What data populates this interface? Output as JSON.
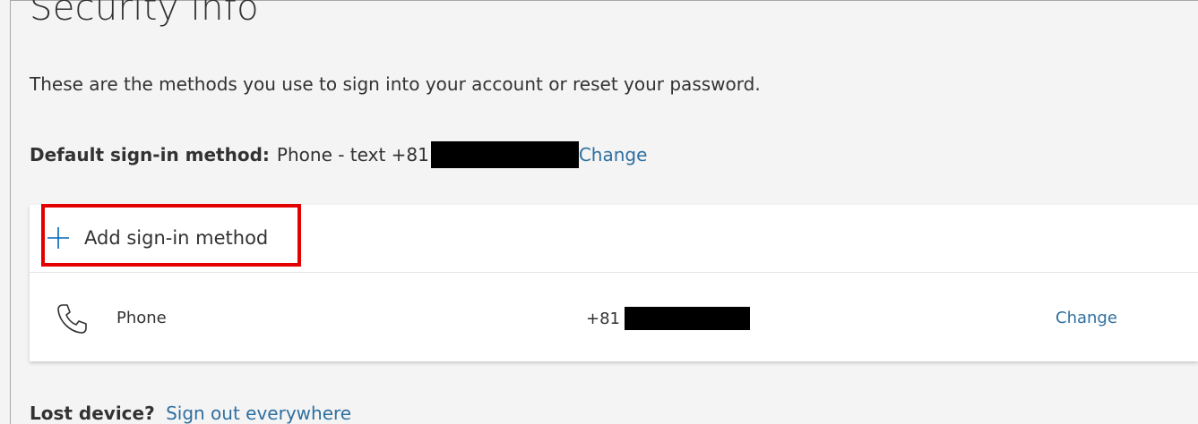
{
  "page": {
    "title": "Security info",
    "description": "These are the methods you use to sign into your account or reset your password."
  },
  "default_method": {
    "label": "Default sign-in method:",
    "value": "Phone - text +81",
    "change_link": "Change"
  },
  "add_method": {
    "label": "Add sign-in method",
    "icon": "plus-icon"
  },
  "methods": [
    {
      "icon": "phone-icon",
      "name": "Phone",
      "value": "+81",
      "change_link": "Change"
    }
  ],
  "lost_device": {
    "label": "Lost device?",
    "link": "Sign out everywhere"
  },
  "colors": {
    "link": "#2f6f9f",
    "highlight": "#e50000",
    "background": "#f4f4f4"
  }
}
